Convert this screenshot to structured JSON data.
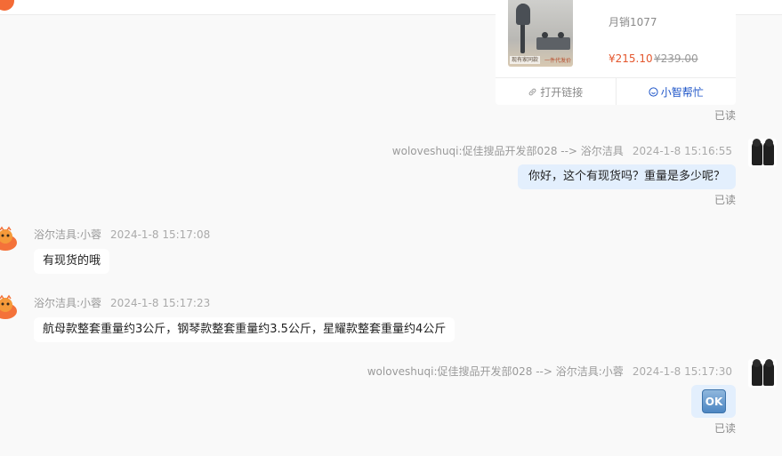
{
  "product_card": {
    "thumb_tag": "现有家同款",
    "thumb_tag2": "一件代发价",
    "sales": "月销1077",
    "price": "¥215.10",
    "old_price": "¥239.00",
    "open_link_label": "打开链接",
    "assistant_label": "小智帮忙"
  },
  "messages": [
    {
      "read_status": "已读"
    },
    {
      "sender": "woloveshuqi:促佳搜品开发部028 --> 浴尔洁具",
      "time": "2024-1-8 15:16:55",
      "text": "你好，这个有现货吗？重量是多少呢？",
      "read_status": "已读"
    },
    {
      "sender": "浴尔洁具:小蓉",
      "time": "2024-1-8 15:17:08",
      "text": "有现货的哦"
    },
    {
      "sender": "浴尔洁具:小蓉",
      "time": "2024-1-8 15:17:23",
      "text": "航母款整套重量约3公斤，钢琴款整套重量约3.5公斤，星耀款整套重量约4公斤"
    },
    {
      "sender": "woloveshuqi:促佳搜品开发部028 --> 浴尔洁具:小蓉",
      "time": "2024-1-8 15:17:30",
      "emoji": "OK",
      "read_status": "已读"
    }
  ],
  "colors": {
    "accent_blue": "#1e55c8",
    "price_red": "#e4572e",
    "mine_bubble": "#e3effd",
    "background": "#f9f9f9"
  },
  "icons": {
    "link": "link-icon",
    "assistant": "assistant-smile-icon",
    "seller_avatar": "orange-mascot-avatar",
    "buyer_avatar": "two-people-avatar"
  }
}
